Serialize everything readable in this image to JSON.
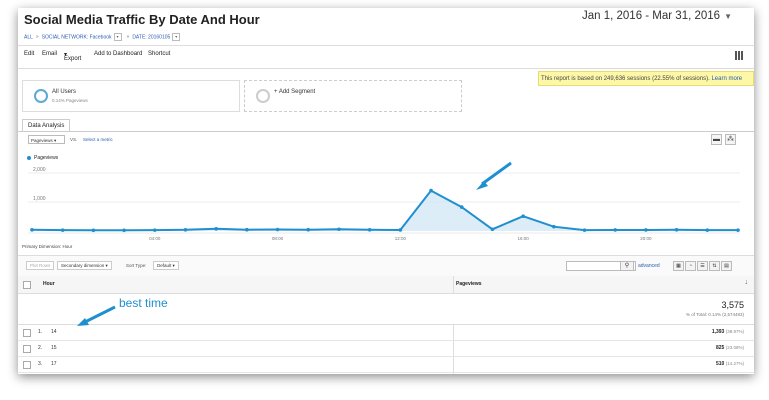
{
  "header": {
    "title": "Social Media Traffic By Date And Hour",
    "date_range": "Jan 1, 2016 - Mar 31, 2016",
    "breadcrumb": {
      "all": "ALL",
      "network": "SOCIAL NETWORK: Facebook",
      "date": "DATE: 20160105"
    }
  },
  "toolbar": {
    "edit": "Edit",
    "email": "Email",
    "export": "Export",
    "add_dashboard": "Add to Dashboard",
    "shortcut": "Shortcut"
  },
  "notice": {
    "text": "This report is based on 249,636 sessions (22.55% of sessions).",
    "link": "Learn more"
  },
  "segments": {
    "all_users": {
      "label": "All Users",
      "sub": "0.14% Pageviews"
    },
    "add": "+ Add Segment"
  },
  "tabs": {
    "data_analysis": "Data Analysis"
  },
  "chart_controls": {
    "metric": "Pageviews",
    "vs": "VS.",
    "select_metric": "Select a metric"
  },
  "chart_data": {
    "type": "line",
    "series": [
      {
        "name": "Pageviews",
        "x": [
          "00:00",
          "01:00",
          "02:00",
          "03:00",
          "04:00",
          "05:00",
          "06:00",
          "07:00",
          "08:00",
          "09:00",
          "10:00",
          "11:00",
          "12:00",
          "13:00",
          "14:00",
          "15:00",
          "16:00",
          "17:00",
          "18:00",
          "19:00",
          "20:00",
          "21:00",
          "22:00",
          "23:00"
        ],
        "values": [
          40,
          30,
          25,
          25,
          30,
          40,
          75,
          45,
          50,
          45,
          60,
          40,
          35,
          1393,
          825,
          60,
          510,
          150,
          30,
          35,
          35,
          40,
          30,
          30
        ]
      }
    ],
    "y_ticks": [
      "2,000",
      "1,000"
    ],
    "x_ticks": [
      "04:00",
      "08:00",
      "12:00",
      "16:00",
      "20:00"
    ],
    "ylim": [
      0,
      2000
    ],
    "color": "#1f8fd0"
  },
  "table_controls": {
    "plot_rows": "Plot Rows",
    "secondary_dimension": "Secondary dimension",
    "sort_type_label": "Sort Type:",
    "sort_type": "Default",
    "advanced": "advanced",
    "primary_dimension": "Primary Dimension: Hour"
  },
  "table": {
    "columns": [
      "Hour",
      "Pageviews"
    ],
    "total": {
      "value": "3,575",
      "sub": "% of Total: 0.14% (2,574483)"
    },
    "rows": [
      {
        "index": "1.",
        "hour": "14",
        "pageviews": "1,393",
        "pct": "(38.97%)"
      },
      {
        "index": "2.",
        "hour": "15",
        "pageviews": "825",
        "pct": "(23.08%)"
      },
      {
        "index": "3.",
        "hour": "17",
        "pageviews": "510",
        "pct": "(14.27%)"
      }
    ]
  },
  "annotations": {
    "best_time": "best time"
  }
}
